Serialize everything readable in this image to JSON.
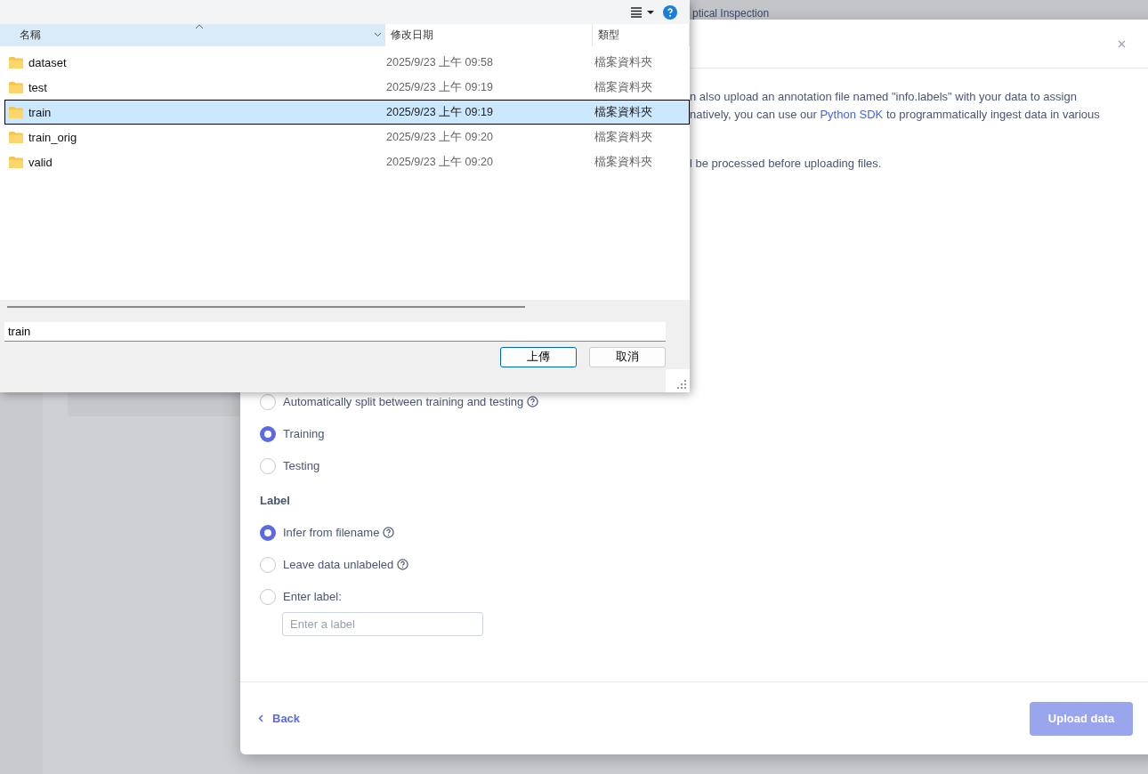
{
  "background": {
    "header_title": "ptical Inspection"
  },
  "modal": {
    "intro_lines": [
      {
        "before": "n also upload an annotation file named \"info.labels\" with your data to assign"
      },
      {
        "before": "natively, you can use our ",
        "link": "Python SDK",
        "after": " to programmatically ingest data in various"
      },
      {
        "before": "l be processed before uploading files."
      }
    ],
    "split_options": [
      {
        "label": "Automatically split between training and testing",
        "help": true,
        "selected": false
      },
      {
        "label": "Training",
        "help": false,
        "selected": true
      },
      {
        "label": "Testing",
        "help": false,
        "selected": false
      }
    ],
    "label_heading": "Label",
    "label_options": [
      {
        "label": "Infer from filename",
        "help": true,
        "selected": true
      },
      {
        "label": "Leave data unlabeled",
        "help": true,
        "selected": false
      },
      {
        "label": "Enter label:",
        "help": false,
        "selected": false
      }
    ],
    "label_input": {
      "placeholder": "Enter a label"
    },
    "back": "Back",
    "upload_button": {
      "label": "Upload data",
      "disabled": true
    }
  },
  "file_dialog": {
    "columns": [
      {
        "label": "名稱",
        "sorted": true
      },
      {
        "label": "修改日期",
        "sorted": false
      },
      {
        "label": "類型",
        "sorted": false
      }
    ],
    "rows": [
      {
        "name": "dataset",
        "date": "2025/9/23 上午 09:58",
        "type": "檔案資料夾",
        "selected": false
      },
      {
        "name": "test",
        "date": "2025/9/23 上午 09:19",
        "type": "檔案資料夾",
        "selected": false
      },
      {
        "name": "train",
        "date": "2025/9/23 上午 09:19",
        "type": "檔案資料夾",
        "selected": true
      },
      {
        "name": "train_orig",
        "date": "2025/9/23 上午 09:20",
        "type": "檔案資料夾",
        "selected": false
      },
      {
        "name": "valid",
        "date": "2025/9/23 上午 09:20",
        "type": "檔案資料夾",
        "selected": false
      }
    ],
    "filename": "train",
    "buttons": [
      {
        "label": "上傳",
        "default": true
      },
      {
        "label": "取消",
        "default": false
      }
    ]
  }
}
